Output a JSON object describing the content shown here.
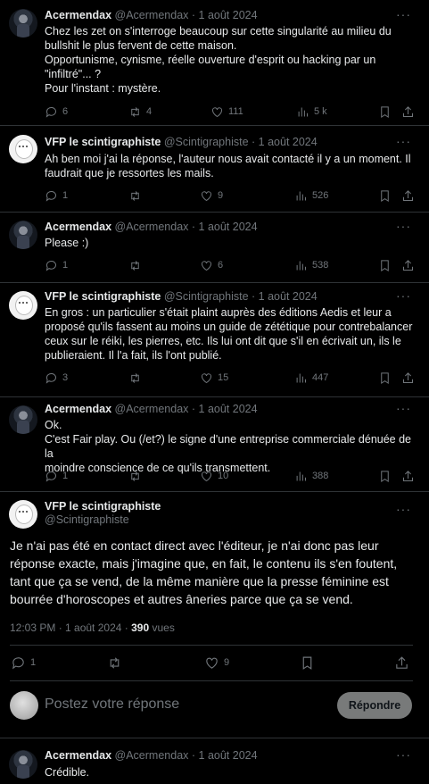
{
  "tweets": [
    {
      "name": "Acermendax",
      "handle": "@Acermendax",
      "date": "· 1 août 2024",
      "lines": [
        "Chez les zet on s'interroge beaucoup sur cette singularité au milieu du",
        "bullshit le plus fervent de cette maison.",
        "Opportunisme, cynisme, réelle ouverture d'esprit ou hacking par un",
        "\"infiltré\"... ?",
        "Pour l'instant : mystère."
      ],
      "replies": "6",
      "retweets": "4",
      "likes": "111",
      "views": "5 k"
    },
    {
      "name": "VFP le scintigraphiste",
      "handle": "@Scintigraphiste",
      "date": "· 1 août 2024",
      "lines": [
        "Ah ben moi j'ai la réponse, l'auteur nous avait contacté il y a un moment. Il",
        "faudrait que je ressortes les mails."
      ],
      "replies": "1",
      "retweets": "",
      "likes": "9",
      "views": "526"
    },
    {
      "name": "Acermendax",
      "handle": "@Acermendax",
      "date": "· 1 août 2024",
      "lines": [
        "Please :)"
      ],
      "replies": "1",
      "retweets": "",
      "likes": "6",
      "views": "538"
    },
    {
      "name": "VFP le scintigraphiste",
      "handle": "@Scintigraphiste",
      "date": "· 1 août 2024",
      "lines": [
        "En gros : un particulier s'était plaint auprès des éditions Aedis et leur a",
        "proposé qu'ils fassent au moins un guide de zététique pour contrebalancer",
        "ceux sur le réiki, les pierres, etc. Ils lui ont dit que s'il en écrivait un, ils le",
        "publieraient. Il l'a fait, ils l'ont publié."
      ],
      "replies": "3",
      "retweets": "",
      "likes": "15",
      "views": "447"
    },
    {
      "name": "Acermendax",
      "handle": "@Acermendax",
      "date": "· 1 août 2024",
      "lines": [
        "Ok.",
        "C'est Fair play. Ou (/et?) le signe d'une entreprise commerciale dénuée de la",
        "moindre conscience de ce qu'ils transmettent."
      ],
      "replies": "1",
      "retweets": "",
      "likes": "10",
      "views": "388"
    }
  ],
  "main": {
    "name": "VFP le scintigraphiste",
    "handle": "@Scintigraphiste",
    "lines": [
      "Je n'ai pas été en contact direct avec l'éditeur, je n'ai donc pas leur",
      "réponse exacte, mais j'imagine que, en fait, le contenu ils s'en foutent,",
      "tant que ça se vend, de la même manière que la presse féminine est",
      "bourrée d'horoscopes et autres âneries parce que ça se vend."
    ],
    "time": "12:03 PM · 1 août 2024 · ",
    "view_count": "390",
    "views_label": "vues",
    "replies": "1",
    "likes": "9"
  },
  "reply_box": {
    "placeholder": "Postez votre réponse",
    "button": "Répondre"
  },
  "last": {
    "name": "Acermendax",
    "handle": "@Acermendax",
    "date": "· 1 août 2024",
    "text": "Crédible."
  },
  "more_glyph": "···"
}
